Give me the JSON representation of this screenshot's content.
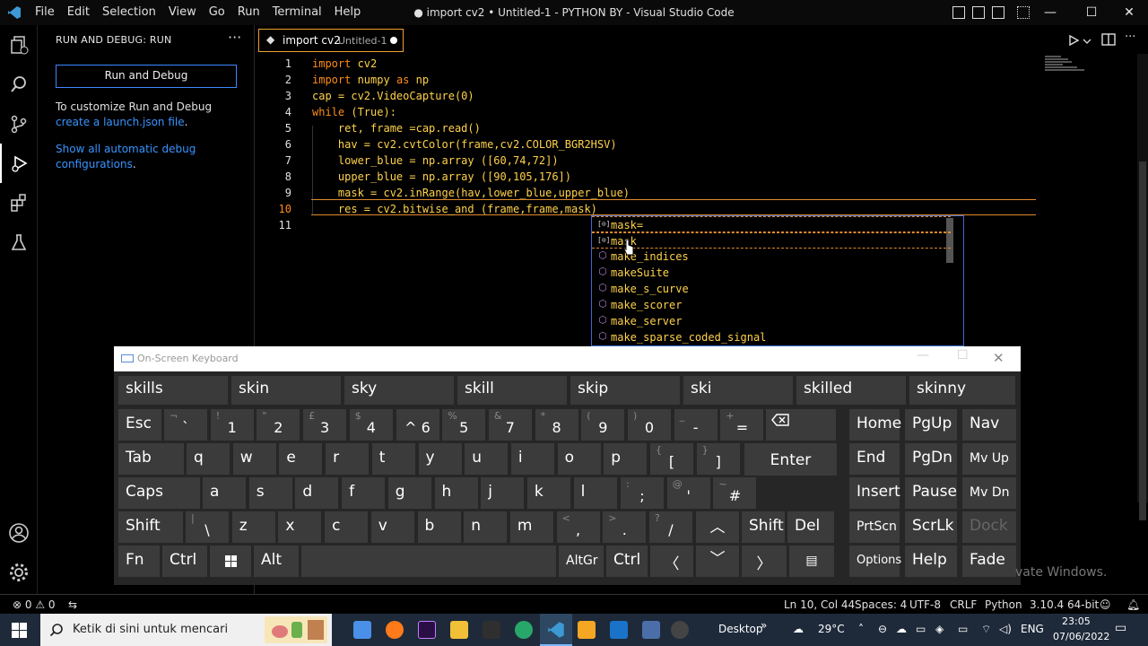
{
  "window": {
    "menu": [
      "File",
      "Edit",
      "Selection",
      "View",
      "Go",
      "Run",
      "Terminal",
      "Help"
    ],
    "title": "● import cv2 • Untitled-1 - PYTHON BY - Visual Studio Code",
    "controls": {
      "minimize": "—",
      "maximize": "☐",
      "close": "✕"
    }
  },
  "sidebar": {
    "header": "RUN AND DEBUG: RUN",
    "more": "···",
    "run_button": "Run and Debug",
    "customize_prefix": "To customize Run and Debug ",
    "customize_link": "create a launch.json file",
    "customize_suffix": ".",
    "show_link": "Show all automatic debug configurations",
    "show_suffix": "."
  },
  "tab": {
    "icon": "◆",
    "name": "import cv2",
    "desc": "Untitled-1"
  },
  "editor": {
    "line_numbers": [
      "1",
      "2",
      "3",
      "4",
      "5",
      "6",
      "7",
      "8",
      "9",
      "10",
      "11"
    ],
    "current_line": 10
  },
  "suggestions": [
    {
      "icon": "[⊙]",
      "label": "mask="
    },
    {
      "icon": "[⊙]",
      "label": "mask"
    },
    {
      "icon": "⬡",
      "label": "make_indices"
    },
    {
      "icon": "⬡",
      "label": "makeSuite"
    },
    {
      "icon": "⬡",
      "label": "make_s_curve"
    },
    {
      "icon": "⬡",
      "label": "make_scorer"
    },
    {
      "icon": "⬡",
      "label": "make_server"
    },
    {
      "icon": "⬡",
      "label": "make_sparse_coded_signal"
    }
  ],
  "osk": {
    "title": "On-Screen Keyboard",
    "predictions": [
      "skills",
      "skin",
      "sky",
      "skill",
      "skip",
      "ski",
      "skilled",
      "skinny"
    ],
    "keys": {
      "esc": "Esc",
      "tab": "Tab",
      "caps": "Caps",
      "shift": "Shift",
      "fn": "Fn",
      "ctrl": "Ctrl",
      "alt": "Alt",
      "altgr": "AltGr",
      "ctrl2": "Ctrl",
      "shift2": "Shift",
      "del": "Del",
      "enter": "Enter",
      "home": "Home",
      "pgup": "PgUp",
      "nav": "Nav",
      "end": "End",
      "pgdn": "PgDn",
      "mvup": "Mv Up",
      "insert": "Insert",
      "pause": "Pause",
      "mvdn": "Mv Dn",
      "prtscn": "PrtScn",
      "scrlk": "ScrLk",
      "dock": "Dock",
      "options": "Options",
      "help": "Help",
      "fade": "Fade"
    },
    "row1": [
      {
        "sup": "¬",
        "main": "`"
      },
      {
        "sup": "!",
        "main": "1"
      },
      {
        "sup": "\"",
        "main": "2"
      },
      {
        "sup": "£",
        "main": "3"
      },
      {
        "sup": "$",
        "main": "4"
      },
      {
        "sup": "%",
        "main": "5"
      },
      {
        "sup": "&",
        "main": "7"
      },
      {
        "sup": "*",
        "main": "8"
      },
      {
        "sup": "(",
        "main": "9"
      },
      {
        "sup": ")",
        "main": "0"
      },
      {
        "sup": "_",
        "main": "-"
      },
      {
        "sup": "+",
        "main": "="
      }
    ],
    "row2": [
      "q",
      "w",
      "e",
      "r",
      "t",
      "y",
      "u",
      "i",
      "o",
      "p"
    ],
    "row2_brackets": [
      {
        "sup": "{",
        "main": "["
      },
      {
        "sup": "}",
        "main": "]"
      }
    ],
    "row3": [
      "a",
      "s",
      "d",
      "f",
      "g",
      "h",
      "j",
      "k",
      "l"
    ],
    "row3_extra": [
      {
        "sup": ":",
        "main": ";"
      },
      {
        "sup": "@",
        "main": "'"
      },
      {
        "sup": "~",
        "main": "#"
      }
    ],
    "row4": [
      {
        "sup": "|",
        "main": "\\"
      },
      {
        "main": "z"
      },
      {
        "main": "x"
      },
      {
        "main": "c"
      },
      {
        "main": "v"
      },
      {
        "main": "b"
      },
      {
        "main": "n"
      },
      {
        "main": "m"
      },
      {
        "sup": "<",
        "main": ","
      },
      {
        "sup": ">",
        "main": "."
      },
      {
        "sup": "?",
        "main": "/"
      }
    ],
    "caret_num": "^ 6"
  },
  "status": {
    "errors": "⊗ 0 ⚠ 0",
    "position": "Ln 10, Col 44",
    "spaces": "Spaces: 4",
    "encoding": "UTF-8",
    "eol": "CRLF",
    "language": "Python",
    "version": "3.10.4 64-bit"
  },
  "taskbar": {
    "search_placeholder": "Ketik di sini untuk mencari",
    "desktop": "Desktop",
    "weather": "29°C",
    "lang": "ENG",
    "time": "23:05",
    "date": "07/06/2022",
    "watermark": "vate Windows."
  }
}
